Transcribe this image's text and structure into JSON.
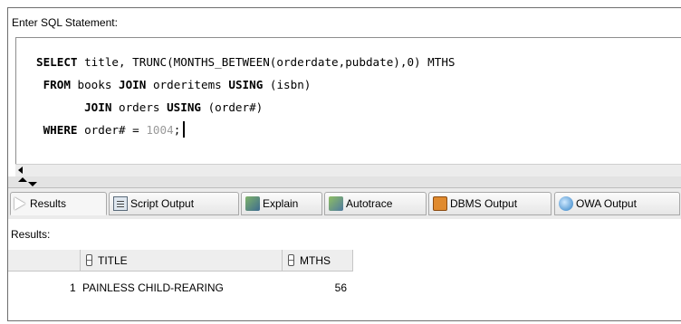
{
  "editor": {
    "label": "Enter SQL Statement:",
    "lines": [
      [
        {
          "t": "SELECT",
          "k": 1
        },
        {
          "t": " title, TRUNC(MONTHS_BETWEEN(orderdate,pubdate),0) MTHS"
        }
      ],
      [
        {
          "t": " "
        },
        {
          "t": "FROM",
          "k": 1
        },
        {
          "t": " books "
        },
        {
          "t": "JOIN",
          "k": 1
        },
        {
          "t": " orderitems "
        },
        {
          "t": "USING",
          "k": 1
        },
        {
          "t": " (isbn)"
        }
      ],
      [
        {
          "t": "       "
        },
        {
          "t": "JOIN",
          "k": 1
        },
        {
          "t": " orders "
        },
        {
          "t": "USING",
          "k": 1
        },
        {
          "t": " (order#)"
        }
      ],
      [
        {
          "t": " "
        },
        {
          "t": "WHERE",
          "k": 1
        },
        {
          "t": " order# = "
        },
        {
          "t": "1004",
          "n": 1
        },
        {
          "t": ";"
        }
      ]
    ]
  },
  "tabs": [
    {
      "label": "Results",
      "icon": "play-icon",
      "active": true
    },
    {
      "label": "Script Output",
      "icon": "script-output-icon"
    },
    {
      "label": "Explain",
      "icon": "explain-plan-icon"
    },
    {
      "label": "Autotrace",
      "icon": "autotrace-icon"
    },
    {
      "label": "DBMS Output",
      "icon": "dbms-output-icon"
    },
    {
      "label": "OWA Output",
      "icon": "owa-globe-icon"
    }
  ],
  "results": {
    "label": "Results:",
    "columns": [
      "TITLE",
      "MTHS"
    ],
    "rows": [
      {
        "row_num": "1",
        "title": "PAINLESS CHILD-REARING",
        "mths": "56"
      }
    ]
  }
}
